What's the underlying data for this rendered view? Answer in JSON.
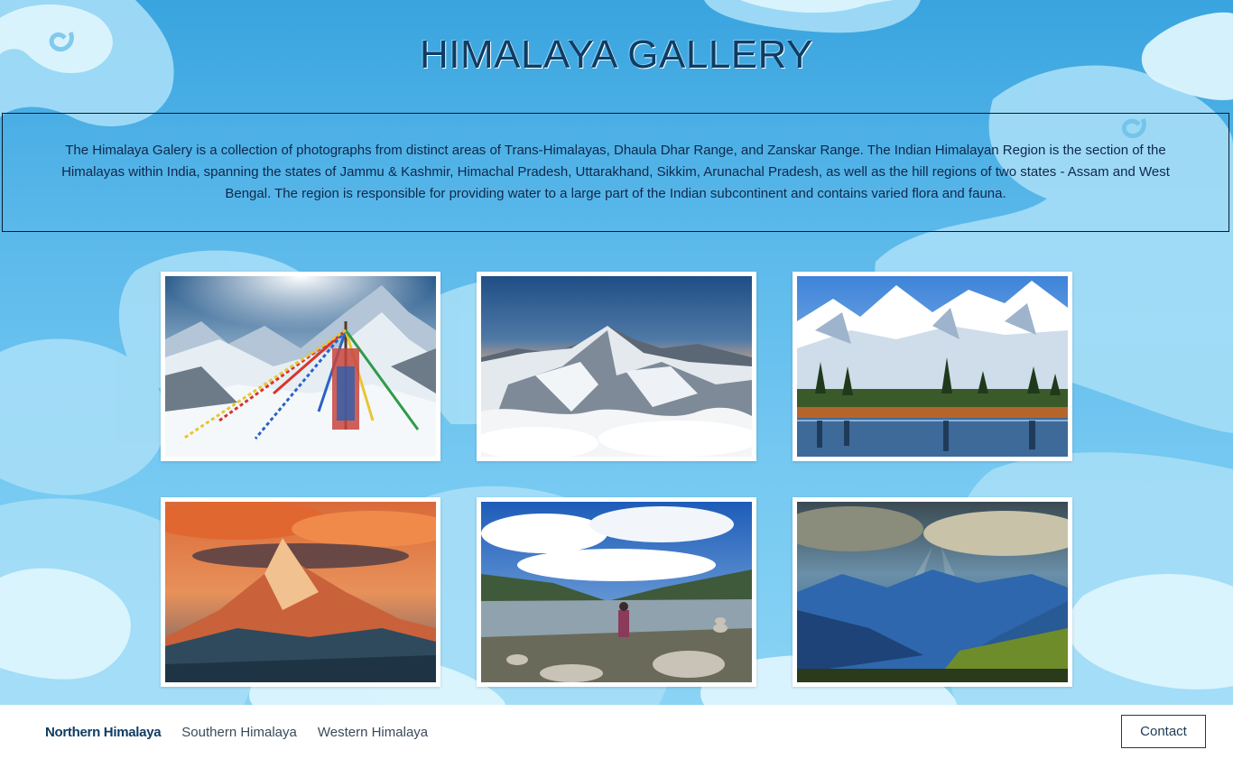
{
  "header": {
    "title": "HIMALAYA GALLERY"
  },
  "description": {
    "text": "The Himalaya Galery is a collection of photographs from distinct areas of Trans-Himalayas, Dhaula Dhar Range, and Zanskar Range. The Indian Himalayan Region is the section of the Himalayas within India, spanning the states of Jammu & Kashmir, Himachal Pradesh, Uttarakhand, Sikkim, Arunachal Pradesh, as well as the hill regions of two states - Assam and West Bengal. The region is responsible for providing water to a large part of the Indian subcontinent and contains varied flora and fauna."
  },
  "gallery": {
    "photos": [
      {
        "subject": "prayer flags on snowy summit"
      },
      {
        "subject": "aerial view of snowy peak above clouds"
      },
      {
        "subject": "snowy range with pine forest and lake reflection"
      },
      {
        "subject": "pointed peak under orange sunset clouds"
      },
      {
        "subject": "lake with rock cairns and cloudy sky"
      },
      {
        "subject": "sun rays over blue mountain valley"
      }
    ]
  },
  "footer": {
    "nav": [
      {
        "label": "Northern Himalaya",
        "active": true
      },
      {
        "label": "Southern Himalaya",
        "active": false
      },
      {
        "label": "Western Himalaya",
        "active": false
      }
    ],
    "contact_label": "Contact"
  },
  "colors": {
    "sky": "#39a4df",
    "cloud": "#bfe9fb",
    "title_text": "#0f3c63",
    "footer_bg": "#ffffff"
  }
}
